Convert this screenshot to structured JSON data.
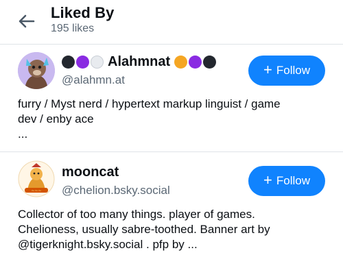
{
  "header": {
    "title": "Liked By",
    "subtitle": "195 likes"
  },
  "users": [
    {
      "display_name": "Alahmnat",
      "handle": "@alahmn.at",
      "follow_label": "Follow",
      "bio": "furry / Myst nerd / hypertext markup linguist / game\ndev / enby ace\n...",
      "emoji_before": [
        "black-circle",
        "purple-circle",
        "white-circle"
      ],
      "emoji_after": [
        "orange-circle",
        "purple-circle",
        "black-circle"
      ]
    },
    {
      "display_name": "mooncat",
      "handle": "@chelion.bsky.social",
      "follow_label": "Follow",
      "bio": "Collector of too many things. player of games.\nChelioness, usually sabre-toothed. Banner art by\n@tigerknight.bsky.social . pfp by ..."
    }
  ],
  "colors": {
    "accent": "#1083fe",
    "muted_text": "#5b6875",
    "divider": "#dfe3e8"
  }
}
